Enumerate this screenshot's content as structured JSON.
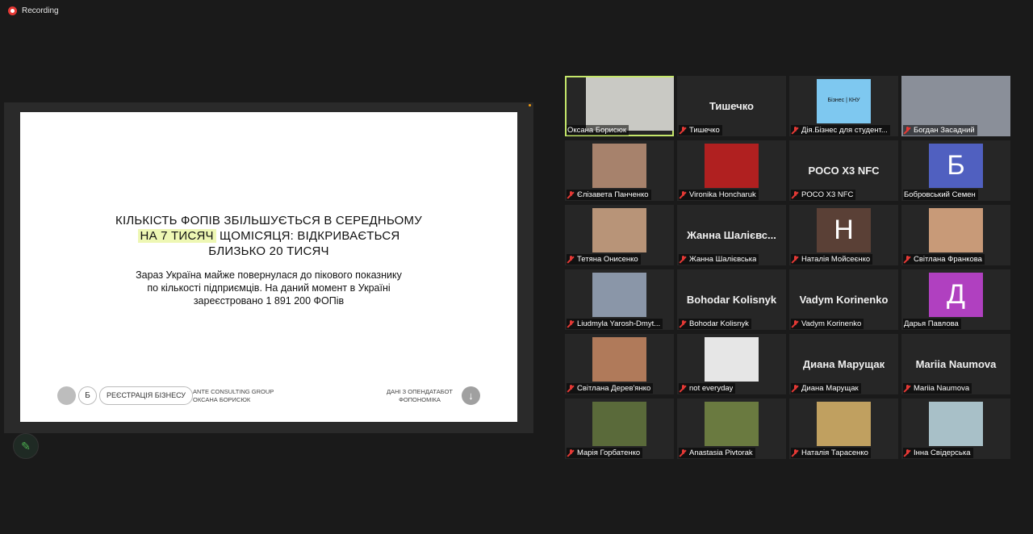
{
  "recording": {
    "label": "Recording"
  },
  "slide": {
    "headline_line1": "КІЛЬКІСТЬ ФОПІВ ЗБІЛЬШУЄТЬСЯ В СЕРЕДНЬОМУ",
    "headline_highlight": "НА 7 ТИСЯЧ",
    "headline_line2_rest": " ЩОМІСЯЦЯ: ВІДКРИВАЄТЬСЯ",
    "headline_line3": "БЛИЗЬКО 20 ТИСЯЧ",
    "body_line1": "Зараз Україна майже повернулася до пікового показнику",
    "body_line2": "по кількості підприємців. На даний момент в Україні",
    "body_line3": "зареєстровано 1 891 200 ФОПів",
    "footer": {
      "letter": "Б",
      "pill_label": "РЕЄСТРАЦІЯ БІЗНЕСУ",
      "company_line1": "ANTE CONSULTING GROUP",
      "company_line2": "ОКСАНА БОРИСЮК",
      "data_line1": "ДАНІ З ОПЕНДАТАБОТ",
      "data_line2": "ФОПОНОМІКА",
      "arrow_glyph": "↓"
    }
  },
  "annotate_icon": "pen-icon",
  "participants": [
    {
      "name": "Оксана Борисюк",
      "kind": "video",
      "muted": false,
      "active": true,
      "bg": "#c9c9c4"
    },
    {
      "name": "Тишечко",
      "kind": "text",
      "display": "Тишечко",
      "muted": true
    },
    {
      "name": "Дія.Бізнес для студент...",
      "kind": "logo",
      "logo_text": "Бізнес | КНУ",
      "muted": true,
      "bg": "#7ec8f0"
    },
    {
      "name": "Богдан Засадний",
      "kind": "video",
      "muted": true,
      "bg": "#8a8f99",
      "wide": true
    },
    {
      "name": "Єлізавета Панченко",
      "kind": "video",
      "muted": true,
      "bg": "#a7826c"
    },
    {
      "name": "Vironika Honcharuk",
      "kind": "video",
      "muted": true,
      "bg": "#b02020"
    },
    {
      "name": "POCO X3 NFC",
      "kind": "text",
      "display": "POCO X3 NFC",
      "muted": true
    },
    {
      "name": "Бобровський Семен",
      "kind": "avatar",
      "letter": "Б",
      "muted": false,
      "bg": "#5060c0"
    },
    {
      "name": "Тетяна Онисенко",
      "kind": "video",
      "muted": true,
      "bg": "#b89478"
    },
    {
      "name": "Жанна Шалієвська",
      "kind": "text",
      "display": "Жанна Шалієвс...",
      "muted": true
    },
    {
      "name": "Наталія Мойсеєнко",
      "kind": "avatar",
      "letter": "Н",
      "muted": true,
      "bg": "#5a4036"
    },
    {
      "name": "Світлана Франкова",
      "kind": "video",
      "muted": true,
      "bg": "#c89a78"
    },
    {
      "name": "Liudmyla Yarosh-Dmyt...",
      "kind": "video",
      "muted": true,
      "bg": "#8a96a8"
    },
    {
      "name": "Bohodar Kolisnyk",
      "kind": "text",
      "display": "Bohodar Kolisnyk",
      "muted": true
    },
    {
      "name": "Vadym Korinenko",
      "kind": "text",
      "display": "Vadym Korinenko",
      "muted": true
    },
    {
      "name": "Дарья Павлова",
      "kind": "avatar",
      "letter": "Д",
      "muted": false,
      "bg": "#b040c0"
    },
    {
      "name": "Світлана Дерев'янко",
      "kind": "video",
      "muted": true,
      "bg": "#b07a5a"
    },
    {
      "name": "not everyday",
      "kind": "video",
      "muted": true,
      "bg": "#e6e6e6"
    },
    {
      "name": "Диана Марущак",
      "kind": "text",
      "display": "Диана Марущак",
      "muted": true
    },
    {
      "name": "Mariia Naumova",
      "kind": "text",
      "display": "Mariia Naumova",
      "muted": true
    },
    {
      "name": "Марія Горбатенко",
      "kind": "video",
      "muted": true,
      "bg": "#5a6a3a"
    },
    {
      "name": "Anastasia Pivtorak",
      "kind": "video",
      "muted": true,
      "bg": "#6a7a40"
    },
    {
      "name": "Наталія Тарасенко",
      "kind": "video",
      "muted": true,
      "bg": "#c0a060"
    },
    {
      "name": "Інна Свідерська",
      "kind": "video",
      "muted": true,
      "bg": "#a8c0c8"
    }
  ]
}
